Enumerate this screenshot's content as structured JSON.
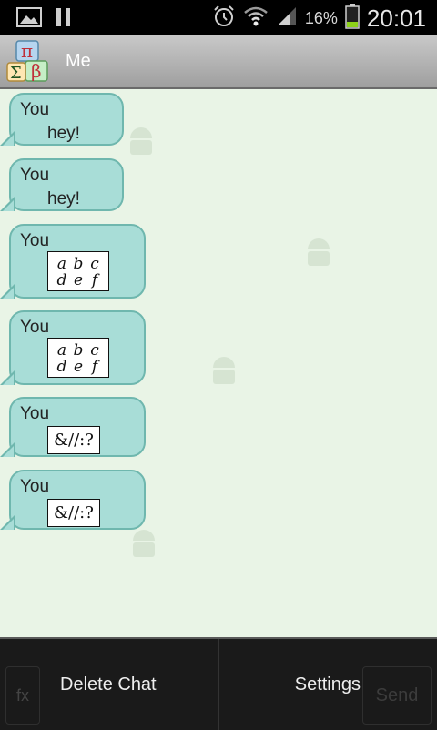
{
  "status_bar": {
    "battery_percent": "16%",
    "time": "20:01"
  },
  "header": {
    "title": "Me"
  },
  "messages": [
    {
      "sender": "You",
      "text": "hey!",
      "type": "text"
    },
    {
      "sender": "You",
      "text": "hey!",
      "type": "text"
    },
    {
      "sender": "You",
      "type": "math-matrix",
      "matrix": [
        "a",
        "b",
        "c",
        "d",
        "e",
        "f"
      ]
    },
    {
      "sender": "You",
      "type": "math-matrix",
      "matrix": [
        "a",
        "b",
        "c",
        "d",
        "e",
        "f"
      ]
    },
    {
      "sender": "You",
      "type": "math-symbols",
      "text": "&//:?"
    },
    {
      "sender": "You",
      "type": "math-symbols",
      "text": "&//:?"
    }
  ],
  "composer": {
    "formula_button": "fx",
    "send_button": "Send"
  },
  "menu": {
    "delete_chat": "Delete Chat",
    "settings": "Settings"
  },
  "colors": {
    "bubble_fill": "#a8ddd7",
    "bubble_border": "#6fb7ae",
    "chat_background": "#e9f4e6"
  }
}
